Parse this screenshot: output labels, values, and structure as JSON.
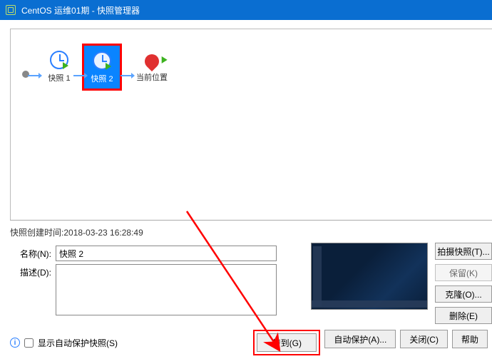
{
  "titlebar": {
    "title": "CentOS 运维01期 - 快照管理器"
  },
  "snapshots": {
    "node1_label": "快照 1",
    "node2_label": "快照 2",
    "current_label": "当前位置"
  },
  "details": {
    "created_label": "快照创建时间:",
    "created_value": "2018-03-23 16:28:49",
    "name_label": "名称(N):",
    "name_value": "快照 2",
    "desc_label": "描述(D):",
    "desc_value": ""
  },
  "side_buttons": {
    "take": "拍摄快照(T)...",
    "keep": "保留(K)",
    "clone": "克隆(O)...",
    "delete": "删除(E)"
  },
  "footer": {
    "show_auto": "显示自动保护快照(S)",
    "goto": "转到(G)",
    "autoprotect": "自动保护(A)...",
    "close": "关闭(C)",
    "help": "帮助"
  }
}
